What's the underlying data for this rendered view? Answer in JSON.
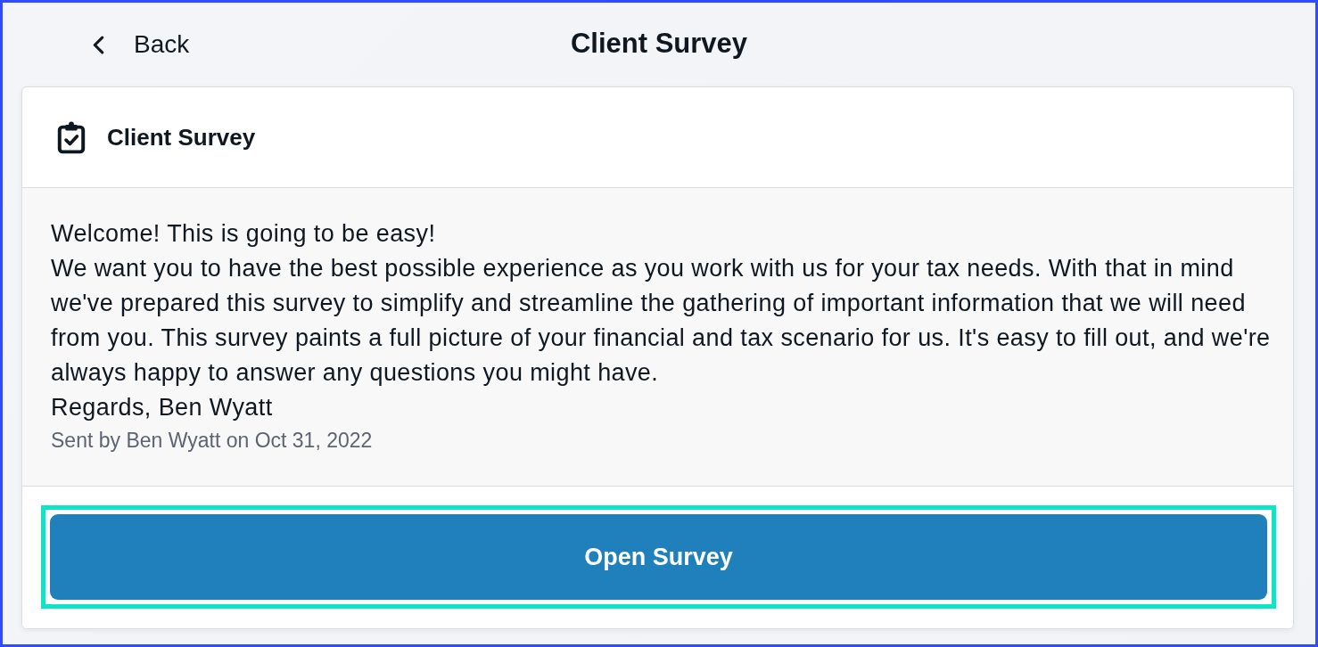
{
  "header": {
    "back_label": "Back",
    "title": "Client Survey"
  },
  "card": {
    "title": "Client Survey",
    "message": [
      "Welcome! This is going to be easy!",
      "We want you to have the best possible experience as you work with us for your tax needs. With that in mind we've prepared this survey to simplify and streamline the gathering of important information that we will need from you. This survey paints a full picture of your financial and tax scenario for us. It's easy to fill out, and we're always happy to answer any questions you might have.",
      "Regards, Ben Wyatt"
    ],
    "meta": "Sent by Ben Wyatt on Oct 31, 2022",
    "button": {
      "label": "Open Survey",
      "highlighted": true
    }
  }
}
